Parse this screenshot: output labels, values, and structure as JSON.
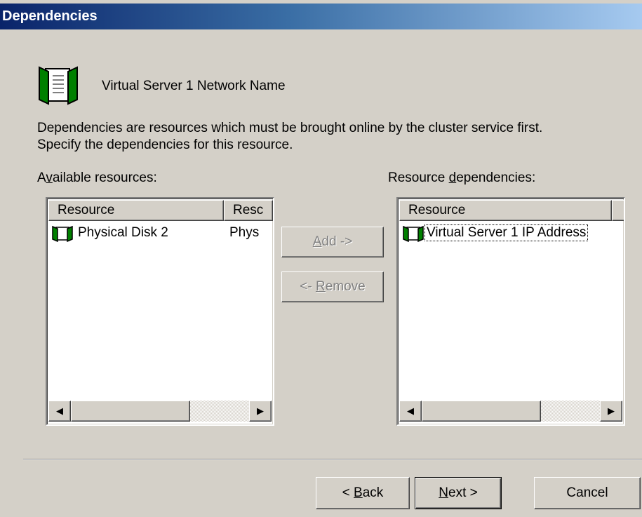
{
  "window": {
    "title": "Dependencies"
  },
  "header": {
    "resource_name": "Virtual Server 1 Network Name",
    "icon": "book-icon"
  },
  "description": {
    "line1": "Dependencies are resources which must be brought online by the cluster service first.",
    "line2": "Specify the dependencies for this resource."
  },
  "available": {
    "label_pre": "A",
    "label_accel": "v",
    "label_post": "ailable resources:",
    "columns": [
      "Resource",
      "Resc"
    ],
    "rows": [
      {
        "name": "Physical Disk 2",
        "type": "Phys"
      }
    ]
  },
  "dependencies": {
    "label_pre": "Resource ",
    "label_accel": "d",
    "label_post": "ependencies:",
    "columns": [
      "Resource"
    ],
    "rows": [
      {
        "name": "Virtual Server 1 IP Address"
      }
    ]
  },
  "actions": {
    "add_accel": "A",
    "add_rest": "dd ->",
    "remove_pre": "<- ",
    "remove_accel": "R",
    "remove_rest": "emove"
  },
  "footer": {
    "back_pre": "< ",
    "back_accel": "B",
    "back_rest": "ack",
    "next_accel": "N",
    "next_rest": "ext >",
    "cancel": "Cancel"
  },
  "colors": {
    "title_bar_start": "#0a246a",
    "title_bar_end": "#a6caf0",
    "face": "#d4d0c8",
    "icon_green": "#008000"
  }
}
